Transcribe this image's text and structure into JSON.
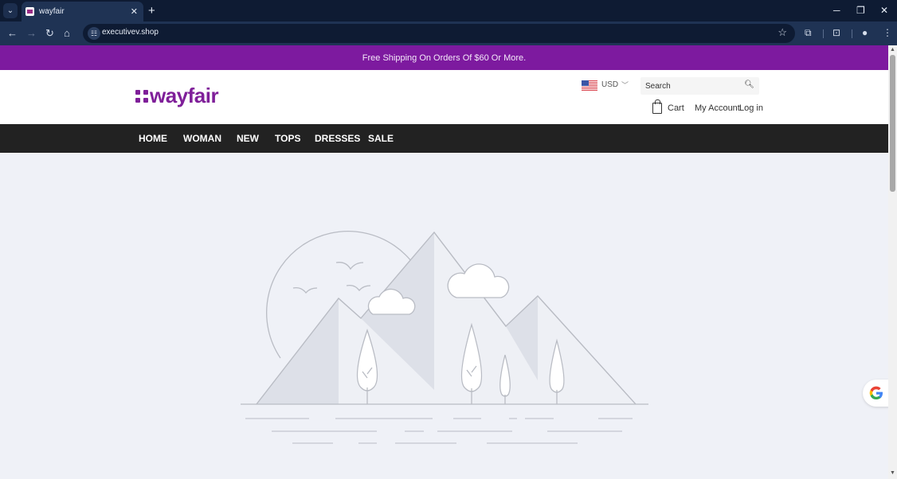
{
  "browser": {
    "tab_title": "wayfair",
    "url": "executivev.shop",
    "icons": {
      "tab_search": "chevron-down-icon",
      "close_tab": "close-icon",
      "new_tab": "plus-icon",
      "minimize": "minimize-icon",
      "restore": "restore-icon",
      "close_window": "close-icon",
      "back": "arrow-left-icon",
      "forward": "arrow-right-icon",
      "reload": "reload-icon",
      "home": "home-icon",
      "site_info": "tune-icon",
      "bookmark": "star-icon",
      "extensions": "puzzle-icon",
      "screenshot": "camera-icon",
      "profile": "person-icon",
      "menu": "kebab-icon"
    }
  },
  "site": {
    "banner": "Free Shipping On Orders Of $60 Or More.",
    "logo_text": "wayfair",
    "currency": "USD",
    "search_placeholder": "Search",
    "cart_label": "Cart",
    "account_label": "My Account",
    "login_label": "Log in",
    "menu": [
      "HOME",
      "WOMAN",
      "NEW",
      "TOPS",
      "DRESSES",
      "SALE"
    ],
    "colors": {
      "brand": "#7d1a9f",
      "menu_bg": "#222222",
      "page_bg": "#eff1f7"
    }
  },
  "main": {
    "illustration": "image-placeholder-landscape"
  }
}
